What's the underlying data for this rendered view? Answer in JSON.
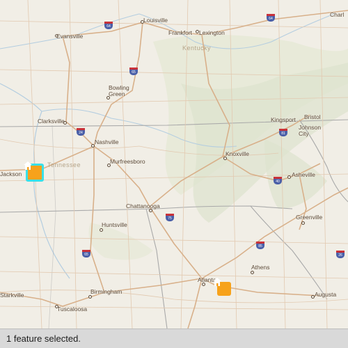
{
  "map": {
    "state_labels": [
      "Kentucky",
      "Tennessee"
    ],
    "cities": [
      "Louisville",
      "Evansville",
      "Frankfort",
      "Lexington",
      "Bowling Green",
      "Clarksville",
      "Nashville",
      "Murfreesboro",
      "Jackson",
      "Knoxville",
      "Kingsport",
      "Bristol",
      "Johnson City",
      "Asheville",
      "Chattanooga",
      "Huntsville",
      "Greenville",
      "Charl",
      "Athens",
      "Atlanta",
      "Birmingham",
      "Tuscaloosa",
      "Augusta",
      "Starkville"
    ],
    "highway_shields": [
      "64",
      "64",
      "65",
      "24",
      "81",
      "75",
      "40",
      "85",
      "65",
      "26"
    ],
    "markers": [
      {
        "name": "home-marker",
        "icon": "house-icon",
        "selected": true
      },
      {
        "name": "home-marker",
        "icon": "house-icon",
        "selected": false
      }
    ],
    "colors": {
      "marker": "#f7a21b",
      "selection": "#38e0e8",
      "interstate": "#c8323a",
      "shield": "#4a5fa8"
    }
  },
  "status": {
    "text": "1 feature selected."
  }
}
